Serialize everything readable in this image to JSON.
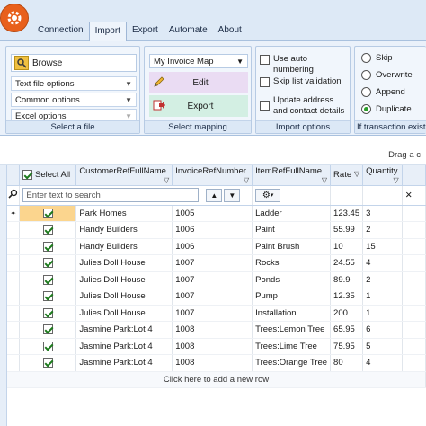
{
  "tabs": [
    {
      "label": "Connection"
    },
    {
      "label": "Import"
    },
    {
      "label": "Export"
    },
    {
      "label": "Automate"
    },
    {
      "label": "About"
    }
  ],
  "ribbon": {
    "select_file": {
      "browse": "Browse",
      "text_file_options": "Text file options",
      "common_options": "Common options",
      "excel_options": "Excel options",
      "label": "Select a file"
    },
    "select_mapping": {
      "map_value": "My Invoice Map",
      "edit": "Edit",
      "export": "Export",
      "label": "Select mapping"
    },
    "import_options": {
      "auto_numbering": "Use auto numbering",
      "skip_list_validation": "Skip list validation",
      "update_address": "Update address and contact details",
      "label": "Import options"
    },
    "if_exists": {
      "skip": "Skip",
      "overwrite": "Overwrite",
      "append": "Append",
      "duplicate": "Duplicate",
      "selected": "Duplicate",
      "label": "If transaction exists"
    }
  },
  "grid": {
    "drag_hint": "Drag a c",
    "columns": {
      "select_all": "Select All",
      "customer": "CustomerRefFullName",
      "invoice": "InvoiceRefNumber",
      "item": "ItemRefFullName",
      "rate": "Rate",
      "quantity": "Quantity"
    },
    "search_placeholder": "Enter text to search",
    "rows": [
      {
        "customer": "Park Homes",
        "invoice": "1005",
        "item": "Ladder",
        "rate": "123.45",
        "quantity": "3"
      },
      {
        "customer": "Handy Builders",
        "invoice": "1006",
        "item": "Paint",
        "rate": "55.99",
        "quantity": "2"
      },
      {
        "customer": "Handy Builders",
        "invoice": "1006",
        "item": "Paint Brush",
        "rate": "10",
        "quantity": "15"
      },
      {
        "customer": "Julies Doll House",
        "invoice": "1007",
        "item": "Rocks",
        "rate": "24.55",
        "quantity": "4"
      },
      {
        "customer": "Julies Doll House",
        "invoice": "1007",
        "item": "Ponds",
        "rate": "89.9",
        "quantity": "2"
      },
      {
        "customer": "Julies Doll House",
        "invoice": "1007",
        "item": "Pump",
        "rate": "12.35",
        "quantity": "1"
      },
      {
        "customer": "Julies Doll House",
        "invoice": "1007",
        "item": "Installation",
        "rate": "200",
        "quantity": "1"
      },
      {
        "customer": "Jasmine Park:Lot 4",
        "invoice": "1008",
        "item": "Trees:Lemon Tree",
        "rate": "65.95",
        "quantity": "6"
      },
      {
        "customer": "Jasmine Park:Lot 4",
        "invoice": "1008",
        "item": "Trees:Lime Tree",
        "rate": "75.95",
        "quantity": "5"
      },
      {
        "customer": "Jasmine Park:Lot 4",
        "invoice": "1008",
        "item": "Trees:Orange Tree",
        "rate": "80",
        "quantity": "4"
      }
    ],
    "add_row": "Click here to add a new row"
  },
  "colors": {
    "accent": "#e8601c",
    "ribbon_bg": "#eaf1fa",
    "current_row": "#fbd58e",
    "edit_btn": "#eadcf3",
    "export_btn": "#d3efe3"
  }
}
